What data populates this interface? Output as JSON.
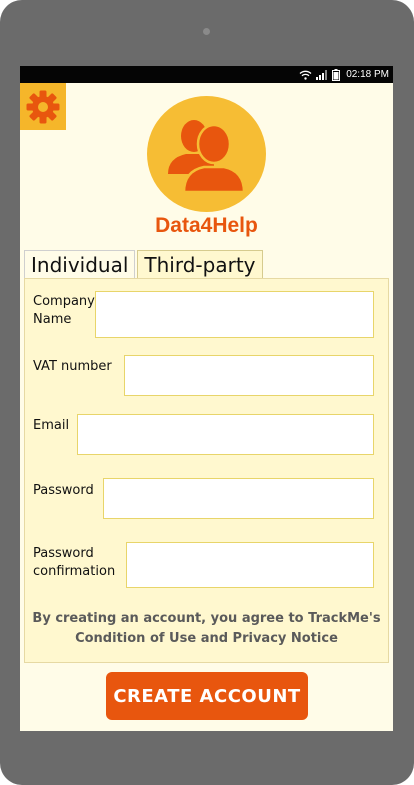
{
  "status_bar": {
    "time": "02:18 PM",
    "icons": [
      "wifi-icon",
      "signal-icon",
      "battery-icon"
    ]
  },
  "header": {
    "settings_icon": "gear-icon",
    "avatar_icon": "users-icon",
    "app_title": "Data4Help"
  },
  "tabs": [
    {
      "label": "Individual",
      "active": false
    },
    {
      "label": "Third-party",
      "active": true
    }
  ],
  "form": {
    "fields": [
      {
        "label_lines": [
          "Company",
          "Name"
        ],
        "value": ""
      },
      {
        "label_lines": [
          "VAT number"
        ],
        "value": ""
      },
      {
        "label_lines": [
          "Email"
        ],
        "value": ""
      },
      {
        "label_lines": [
          "Password"
        ],
        "value": ""
      },
      {
        "label_lines": [
          "Password",
          "confirmation"
        ],
        "value": ""
      }
    ],
    "terms_line1": "By creating an account, you agree to TrackMe's",
    "terms_line2": "Condition of Use and Privacy Notice"
  },
  "actions": {
    "create_label": "CREATE ACCOUNT"
  },
  "colors": {
    "accent": "#e8560e",
    "avatar_bg": "#f6bd34",
    "gear_bg": "#f5b62a",
    "panel_bg": "#fff8cf",
    "screen_bg": "#fffce8",
    "device": "#6b6b6b"
  }
}
